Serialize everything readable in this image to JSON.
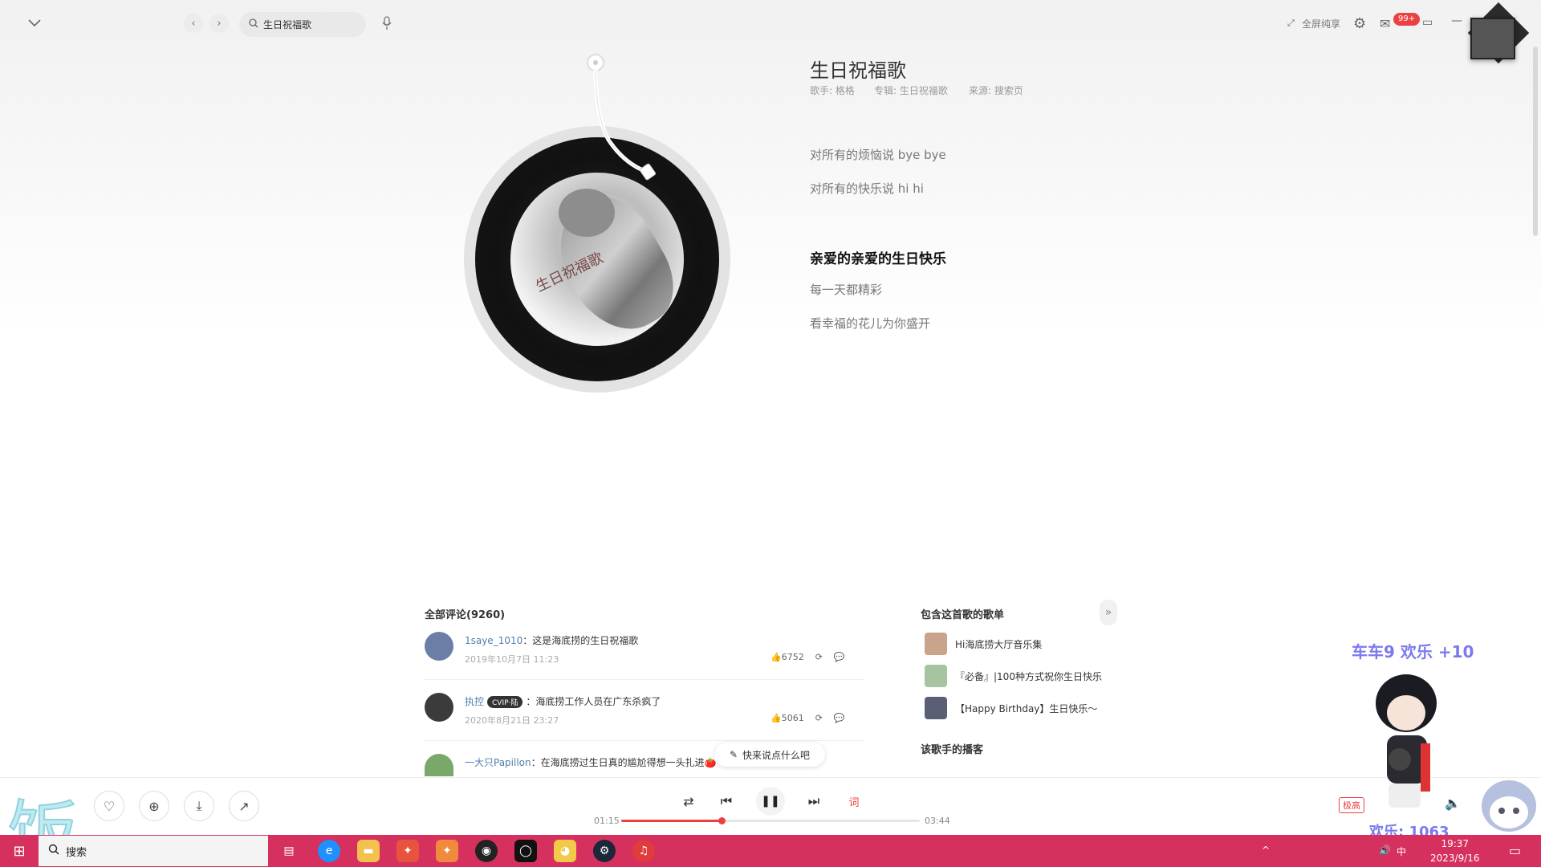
{
  "topbar": {
    "search_value": "生日祝福歌",
    "fullscreen_label": "全屏纯享",
    "mail_badge": "99+"
  },
  "song": {
    "title": "生日祝福歌",
    "singer": "歌手: 格格",
    "album": "专辑: 生日祝福歌",
    "source": "来源: 搜索页",
    "cover_text": "生日祝福歌"
  },
  "lyrics": [
    {
      "text": "对所有的烦恼说 bye bye",
      "active": false
    },
    {
      "text": "对所有的快乐说 hi hi",
      "active": false
    },
    {
      "text": "亲爱的亲爱的生日快乐",
      "active": true
    },
    {
      "text": "每一天都精彩",
      "active": false
    },
    {
      "text": "看幸福的花儿为你盛开",
      "active": false
    }
  ],
  "comments": {
    "title": "全部评论(9260)",
    "items": [
      {
        "user": "1saye_1010",
        "text": "：这是海底捞的生日祝福歌",
        "time": "2019年10月7日 11:23",
        "likes": "6752",
        "avatar_color": "#6b7fa6"
      },
      {
        "user": "执控",
        "badge": "CVIP·陆",
        "text": "：海底捞工作人员在广东杀疯了",
        "time": "2020年8月21日 23:27",
        "likes": "5061",
        "avatar_color": "#3b3b3b"
      },
      {
        "user": "一大只Papillon",
        "text": "：在海底捞过生日真的尴尬得想一头扎进",
        "avatar_color": "#7aa86b"
      }
    ],
    "write_placeholder": "快来说点什么吧"
  },
  "playlists": {
    "title": "包含这首歌的歌单",
    "items": [
      {
        "name": "Hi海底捞大厅音乐集",
        "color": "#c9a48a"
      },
      {
        "name": "『必备』|100种方式祝你生日快乐",
        "color": "#a7c4a0"
      },
      {
        "name": "【Happy Birthday】生日快乐～",
        "color": "#5a5f73"
      }
    ]
  },
  "podcasts": {
    "title": "该歌手的播客"
  },
  "player": {
    "current_time": "01:15",
    "total_time": "03:44",
    "progress_fraction": 0.335,
    "quality": "极高"
  },
  "overlay": {
    "stream_text_1": "车车9 欢乐 +10",
    "stream_text_2": "欢乐: 1063",
    "fan_char": "饭"
  },
  "taskbar": {
    "search_label": "搜索",
    "time": "19:37",
    "date": "2023/9/16",
    "ime": "中"
  },
  "colors": {
    "accent": "#ec4141",
    "taskbar": "#d6305e"
  }
}
